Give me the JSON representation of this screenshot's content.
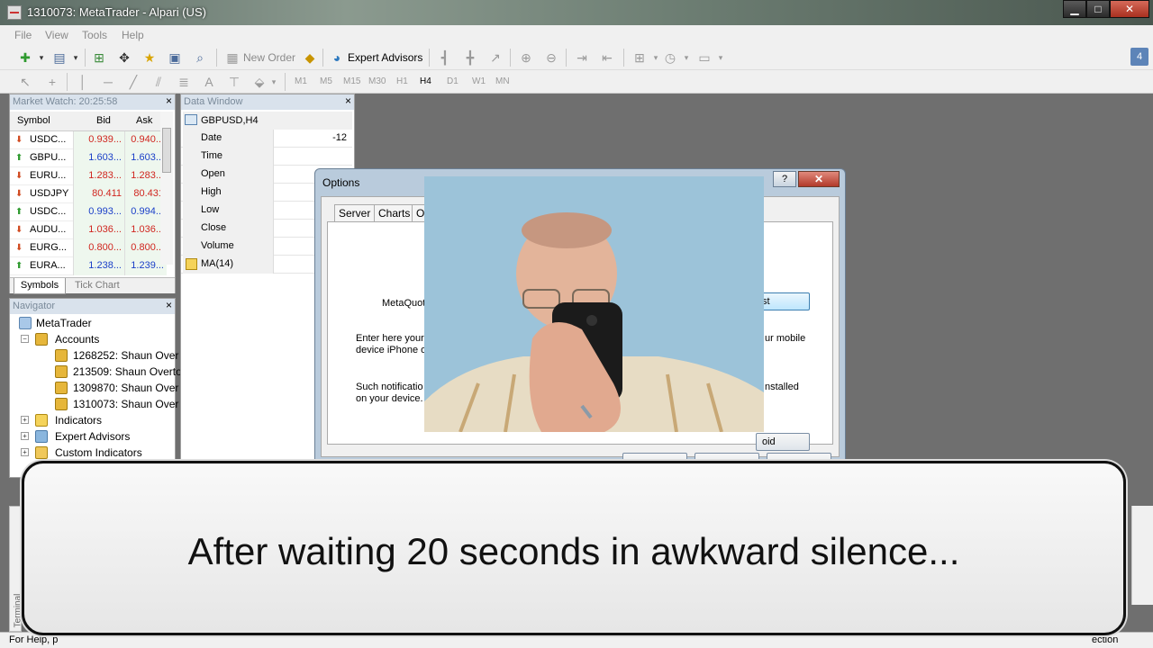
{
  "window": {
    "title": "1310073: MetaTrader - Alpari (US)"
  },
  "menu": [
    "File",
    "View",
    "Tools",
    "Help"
  ],
  "toolbar": {
    "new_order": "New Order",
    "expert_advisors": "Expert Advisors",
    "badge": "4",
    "text_tool": "A",
    "timeframes": [
      "M1",
      "M5",
      "M15",
      "M30",
      "H1",
      "H4",
      "D1",
      "W1",
      "MN"
    ],
    "selected_timeframe": "H4"
  },
  "market_watch": {
    "title": "Market Watch: 20:25:58",
    "columns": {
      "symbol": "Symbol",
      "bid": "Bid",
      "ask": "Ask"
    },
    "rows": [
      {
        "symbol": "USDC...",
        "bid": "0.939...",
        "ask": "0.940...",
        "dir": "down",
        "color": "red"
      },
      {
        "symbol": "GBPU...",
        "bid": "1.603...",
        "ask": "1.603...",
        "dir": "up",
        "color": "blue"
      },
      {
        "symbol": "EURU...",
        "bid": "1.283...",
        "ask": "1.283...",
        "dir": "down",
        "color": "red"
      },
      {
        "symbol": "USDJPY",
        "bid": "80.411",
        "ask": "80.431",
        "dir": "down",
        "color": "red"
      },
      {
        "symbol": "USDC...",
        "bid": "0.993...",
        "ask": "0.994...",
        "dir": "up",
        "color": "blue"
      },
      {
        "symbol": "AUDU...",
        "bid": "1.036...",
        "ask": "1.036...",
        "dir": "down",
        "color": "red"
      },
      {
        "symbol": "EURG...",
        "bid": "0.800...",
        "ask": "0.800...",
        "dir": "down",
        "color": "red"
      },
      {
        "symbol": "EURA...",
        "bid": "1.238...",
        "ask": "1.239...",
        "dir": "up",
        "color": "blue"
      }
    ],
    "tabs": {
      "symbols": "Symbols",
      "tick_chart": "Tick Chart"
    }
  },
  "navigator": {
    "title": "Navigator",
    "root": "MetaTrader",
    "accounts_label": "Accounts",
    "accounts": [
      "1268252: Shaun Over",
      "213509: Shaun Overto",
      "1309870: Shaun Over",
      "1310073: Shaun Over"
    ],
    "indicators": "Indicators",
    "expert_advisors": "Expert Advisors",
    "custom_indicators": "Custom Indicators"
  },
  "data_window": {
    "title": "Data Window",
    "symbol": "GBPUSD,H4",
    "rows": [
      {
        "key": "Date",
        "value": "-12"
      },
      {
        "key": "Time",
        "value": ""
      },
      {
        "key": "Open",
        "value": ""
      },
      {
        "key": "High",
        "value": ""
      },
      {
        "key": "Low",
        "value": ""
      },
      {
        "key": "Close",
        "value": ""
      },
      {
        "key": "Volume",
        "value": ""
      }
    ],
    "indicator": "MA(14)"
  },
  "options_dialog": {
    "title": "Options",
    "help": "?",
    "close": "✕",
    "tabs": [
      "Server",
      "Charts",
      "Obj"
    ],
    "metaquotes_label": "MetaQuote",
    "test_button": "st",
    "enter_text_left": "Enter here your",
    "enter_text_left2": "device iPhone o",
    "enter_text_right": "ur mobile",
    "notif_text_left": "Such notificatio",
    "notif_text_left2": "on your device.",
    "notif_text_right": "nstalled",
    "android_button": "oid"
  },
  "terminal": {
    "label": "Terminal"
  },
  "status_bar": {
    "left": "For Help, p",
    "right": "ection"
  },
  "caption": {
    "text": "After waiting 20 seconds in awkward silence..."
  }
}
